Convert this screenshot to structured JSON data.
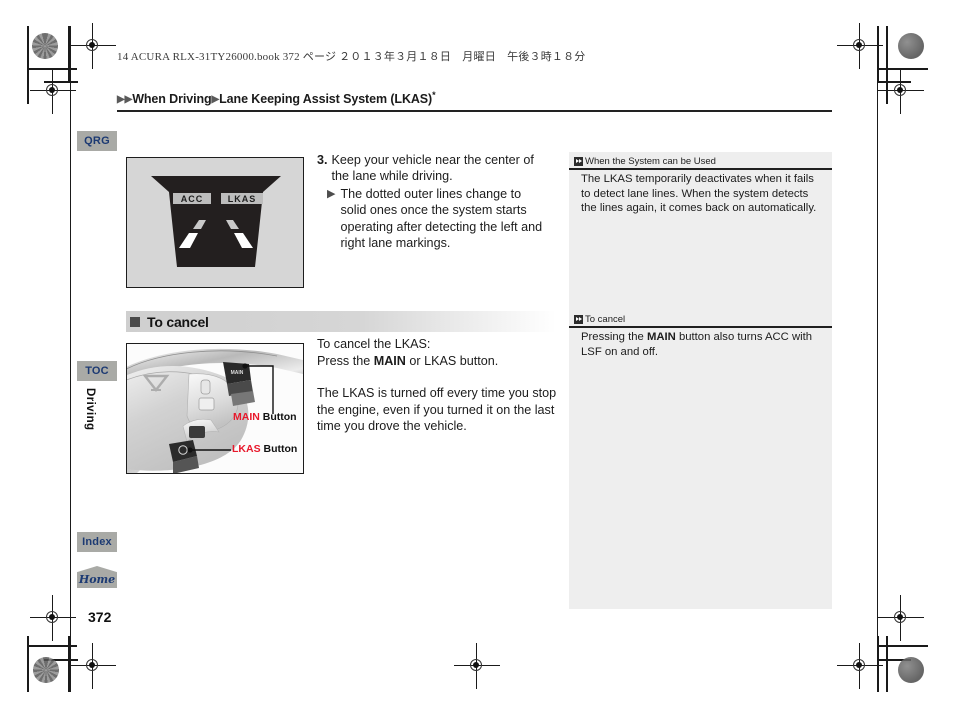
{
  "file_header": "14 ACURA RLX-31TY26000.book  372 ページ  ２０１３年３月１８日　月曜日　午後３時１８分",
  "breadcrumb": {
    "arrow": "▶",
    "section": "When Driving",
    "topic": "Lane Keeping Assist System (LKAS)",
    "superscript": "*"
  },
  "side_nav": {
    "qrg_label": "QRG",
    "toc_label": "TOC",
    "index_label": "Index",
    "home_label": "Home",
    "chapter_label": "Driving",
    "page_number": "372"
  },
  "figure_display": {
    "acc_label": "ACC",
    "lkas_label": "LKAS",
    "panel_bg": "#d6d6d6",
    "screen_color": "#231f1f"
  },
  "step": {
    "number": "3.",
    "text": "Keep your vehicle near the center of the lane while driving.",
    "bullet_arrow": "▶",
    "bullet_text": "The dotted outer lines change to solid ones once the system starts operating after detecting the left and right lane markings."
  },
  "section_heading": {
    "title": "To cancel"
  },
  "figure_wheel": {
    "callout_main_accent": "MAIN",
    "callout_main_rest": " Button",
    "callout_lkas_accent": "LKAS",
    "callout_lkas_rest": " Button",
    "accent_color": "#e8192c",
    "main_switch_text": "MAIN"
  },
  "cancel_body": {
    "line1": "To cancel the LKAS:",
    "line2_pre": "Press the ",
    "line2_bold": "MAIN",
    "line2_post": " or LKAS button.",
    "paragraph2": "The LKAS is turned off every time you stop the engine, even if you turned it on the last time you drove the vehicle."
  },
  "sidebar": {
    "panel1": {
      "title": "When the System can be Used",
      "body": "The LKAS temporarily deactivates when it fails to detect lane lines. When the system detects the lines again, it comes back on automatically."
    },
    "panel2": {
      "title": "To cancel",
      "body_pre": "Pressing the ",
      "body_bold": "MAIN",
      "body_post": " button also turns ACC with LSF on and off."
    }
  }
}
